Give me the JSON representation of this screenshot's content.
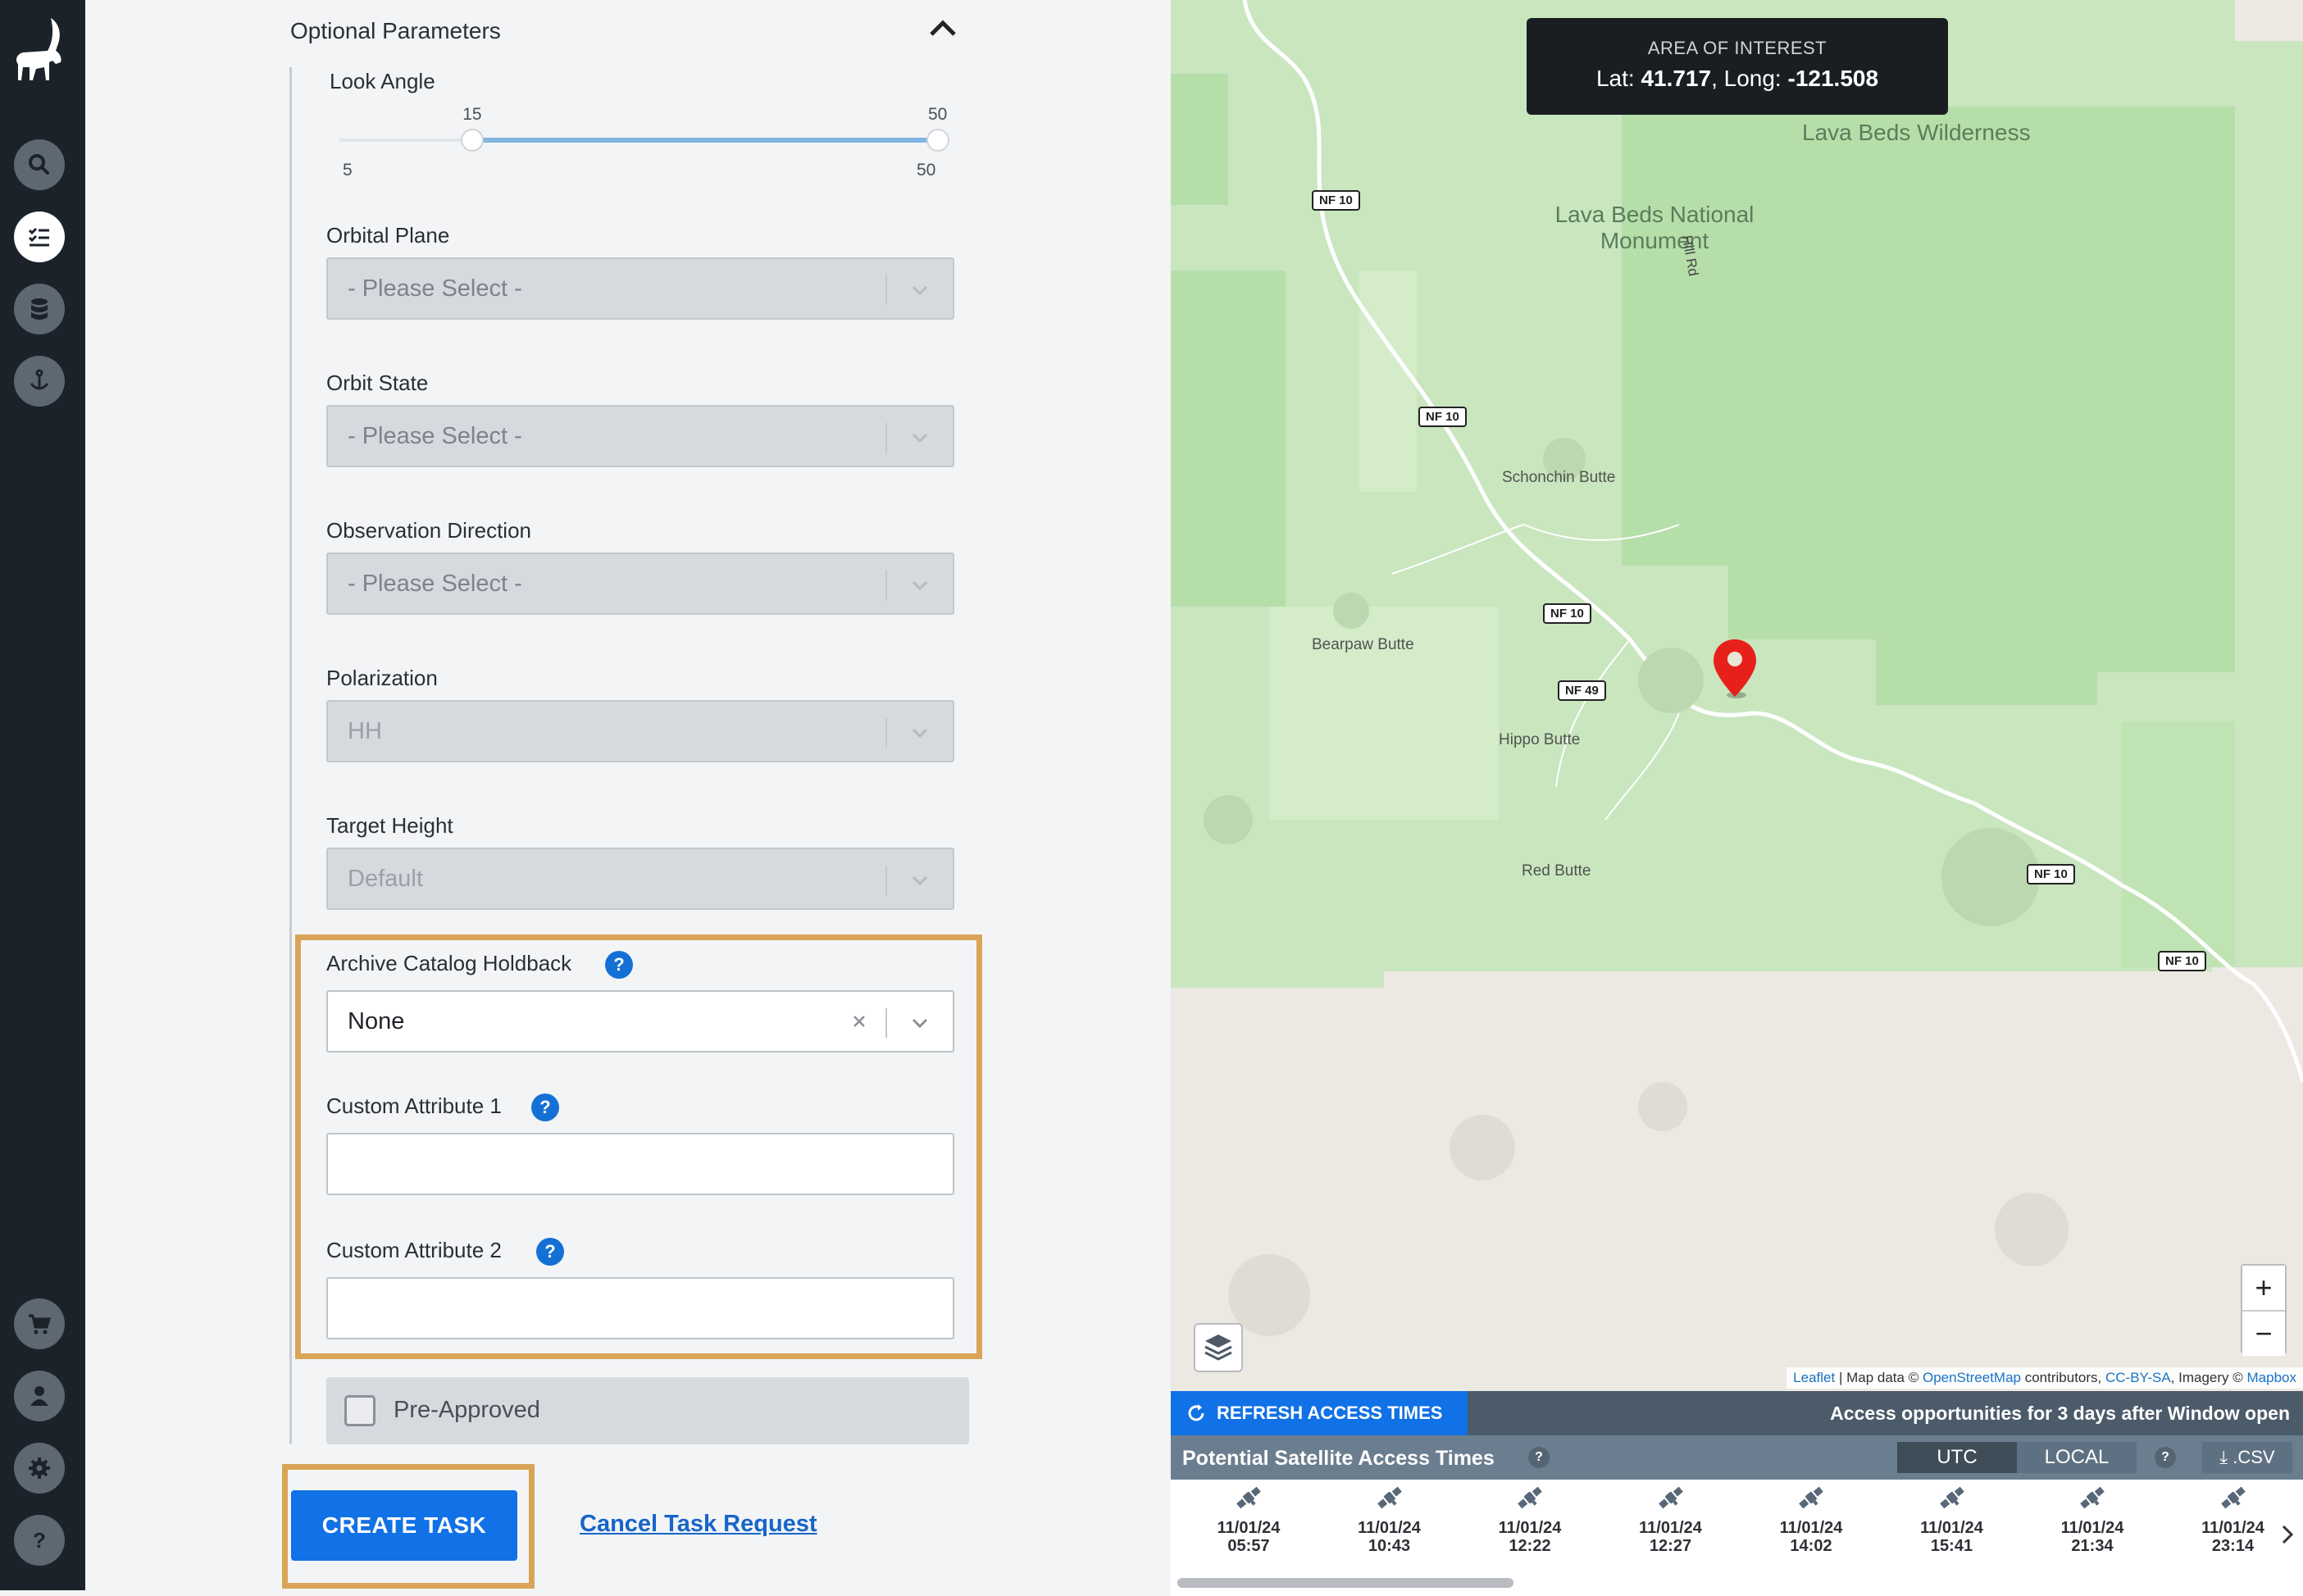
{
  "sidebar": {
    "nav": [
      {
        "name": "search-icon"
      },
      {
        "name": "task-list-icon"
      },
      {
        "name": "database-icon"
      },
      {
        "name": "anchor-icon"
      },
      {
        "name": "cart-icon"
      },
      {
        "name": "user-icon"
      },
      {
        "name": "gear-icon"
      },
      {
        "name": "help-icon"
      }
    ]
  },
  "form": {
    "section_title": "Optional Parameters",
    "look_angle": {
      "label": "Look Angle",
      "min_label": "5",
      "max_label": "50",
      "low": "15",
      "high": "50",
      "min": 5,
      "max": 50,
      "low_value": 15,
      "high_value": 50
    },
    "orbital_plane": {
      "label": "Orbital Plane",
      "value": "- Please Select -"
    },
    "orbit_state": {
      "label": "Orbit State",
      "value": "- Please Select -"
    },
    "observation_direction": {
      "label": "Observation Direction",
      "value": "- Please Select -"
    },
    "polarization": {
      "label": "Polarization",
      "value": "HH"
    },
    "target_height": {
      "label": "Target Height",
      "value": "Default"
    },
    "archive_holdback": {
      "label": "Archive Catalog Holdback",
      "value": "None"
    },
    "custom_attr_1": {
      "label": "Custom Attribute 1",
      "value": ""
    },
    "custom_attr_2": {
      "label": "Custom Attribute 2",
      "value": ""
    },
    "pre_approved": {
      "label": "Pre-Approved",
      "checked": false
    },
    "help_glyph": "?",
    "create_label": "CREATE TASK",
    "cancel_label": "Cancel Task Request",
    "highlight_color": "#d9a458",
    "primary_color": "#1171e6"
  },
  "map": {
    "aoi_title": "AREA OF INTEREST",
    "lat_label": "Lat:",
    "lat": "41.717",
    "long_label": "Long:",
    "long": "-121.508",
    "places": {
      "wilderness": "Lava Beds Wilderness",
      "monument_1": "Lava Beds National",
      "monument_2": "Monument",
      "schonchin": "Schonchin Butte",
      "bearpaw": "Bearpaw Butte",
      "hippo": "Hippo Butte",
      "red": "Red Butte"
    },
    "roads": {
      "nf10": "NF 10",
      "nf49": "NF 49",
      "hill_rd": "Hill Rd"
    },
    "zoom_in": "+",
    "zoom_out": "−",
    "attribution": {
      "leaflet": "Leaflet",
      "sep": "|",
      "map_data": "Map data ©",
      "osm": "OpenStreetMap",
      "contributors": "contributors,",
      "license": "CC-BY-SA",
      "imagery": ", Imagery ©",
      "mapbox": "Mapbox"
    },
    "colors": {
      "park": "#c9e6bf",
      "park_dark": "#b2dca3",
      "land": "#ece8e2",
      "pin": "#e8201b"
    }
  },
  "access": {
    "refresh_label": "REFRESH ACCESS TIMES",
    "opportunity_text": "Access opportunities for 3 days after Window open",
    "title": "Potential Satellite Access Times",
    "help_glyph": "?",
    "utc_label": "UTC",
    "local_label": "LOCAL",
    "csv_label": ".CSV",
    "slots": [
      {
        "date": "11/01/24",
        "time": "05:57"
      },
      {
        "date": "11/01/24",
        "time": "10:43"
      },
      {
        "date": "11/01/24",
        "time": "12:22"
      },
      {
        "date": "11/01/24",
        "time": "12:27"
      },
      {
        "date": "11/01/24",
        "time": "14:02"
      },
      {
        "date": "11/01/24",
        "time": "15:41"
      },
      {
        "date": "11/01/24",
        "time": "21:34"
      },
      {
        "date": "11/01/24",
        "time": "23:14"
      }
    ]
  }
}
